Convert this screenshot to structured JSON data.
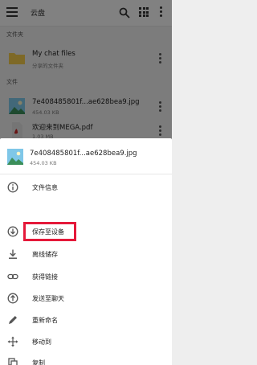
{
  "appbar": {
    "title": "云盘",
    "menu_icon": "hamburger-menu-icon",
    "search_icon": "search-icon",
    "grid_icon": "grid-view-icon",
    "more_icon": "more-vert-icon"
  },
  "sections": {
    "folders": "文件夹",
    "files": "文件"
  },
  "folder": {
    "name": "My chat files",
    "sub": "分享的文件夹"
  },
  "files": [
    {
      "name": "7e408485801f...ae628bea9.jpg",
      "size": "454.03 KB"
    },
    {
      "name": "欢迎来到MEGA.pdf",
      "size": "1.03 MB"
    }
  ],
  "sheet": {
    "file_name": "7e408485801f...ae628bea9.jpg",
    "file_size": "454.03 KB",
    "actions": [
      {
        "label": "文件信息",
        "icon": "info-icon"
      },
      {
        "label": "保存至设备",
        "icon": "download-circle-icon"
      },
      {
        "label": "离线储存",
        "icon": "offline-download-icon"
      },
      {
        "label": "获得链接",
        "icon": "link-icon"
      },
      {
        "label": "发送至聊天",
        "icon": "send-to-chat-icon"
      },
      {
        "label": "重新命名",
        "icon": "rename-pencil-icon"
      },
      {
        "label": "移动到",
        "icon": "move-icon"
      },
      {
        "label": "复制",
        "icon": "copy-icon"
      }
    ]
  },
  "colors": {
    "highlight": "#e5193a",
    "folder": "#f2c94c"
  }
}
